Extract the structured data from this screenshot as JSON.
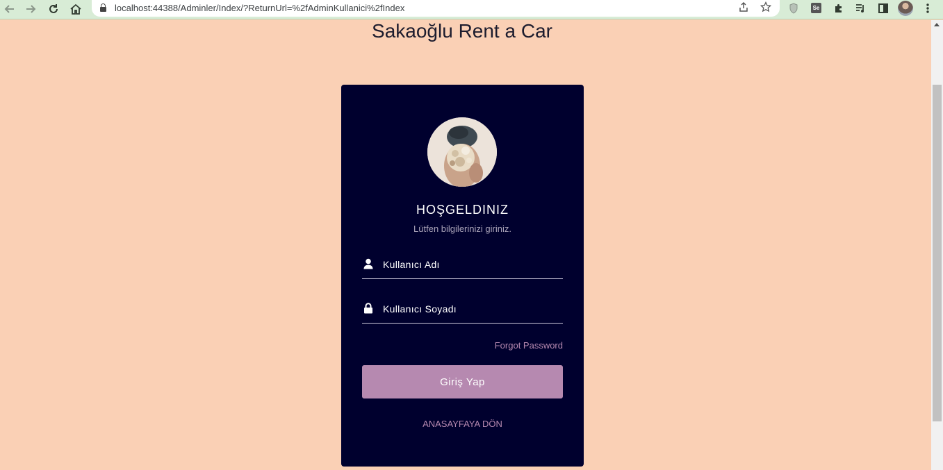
{
  "browser": {
    "url": "localhost:44388/Adminler/Index/?ReturnUrl=%2fAdminKullanici%2fIndex",
    "extension_se_label": "Se"
  },
  "page": {
    "title": "Sakaoğlu Rent a Car"
  },
  "login_card": {
    "welcome": "HOŞGELDINIZ",
    "subtitle": "Lütfen bilgilerinizi giriniz.",
    "username_placeholder": "Kullanıcı Adı",
    "password_placeholder": "Kullanıcı Soyadı",
    "forgot_password": "Forgot Password",
    "login_button": "Giriş Yap",
    "home_link": "ANASAYFAYA DÖN"
  },
  "colors": {
    "page_background": "#fad0b5",
    "card_background": "#00002e",
    "accent": "#b689b0",
    "browser_toolbar": "#d8ecd6"
  }
}
